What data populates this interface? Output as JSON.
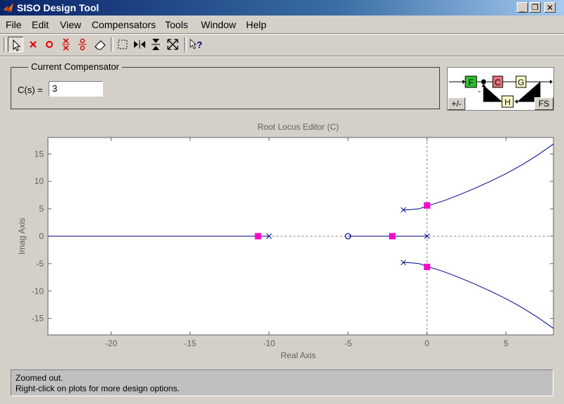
{
  "window": {
    "title": "SISO Design Tool",
    "controls": [
      "_",
      "❐",
      "✕"
    ]
  },
  "menu": [
    "File",
    "Edit",
    "View",
    "Compensators",
    "Tools",
    "Window",
    "Help"
  ],
  "toolbar": [
    {
      "name": "select-arrow-icon"
    },
    {
      "name": "add-real-pole-icon"
    },
    {
      "name": "add-real-zero-icon"
    },
    {
      "name": "add-complex-pole-icon"
    },
    {
      "name": "add-complex-zero-icon"
    },
    {
      "name": "eraser-icon"
    },
    {
      "name": "zoom-box-icon"
    },
    {
      "name": "zoom-x-icon"
    },
    {
      "name": "zoom-y-icon"
    },
    {
      "name": "zoom-fit-icon"
    },
    {
      "name": "whats-this-help-icon"
    }
  ],
  "compensator": {
    "legend": "Current Compensator",
    "label": "C(s) =",
    "value": "3"
  },
  "block_diagram": {
    "blocks": [
      "F",
      "C",
      "G",
      "H"
    ],
    "minus": "-",
    "sign_button": "+/-",
    "fs_button": "FS"
  },
  "colors": {
    "F": "#2fbf2f",
    "C": "#e8747a",
    "G": "#ffffcc",
    "H": "#ffffcc",
    "locus": "#00008b",
    "marker": "#ff00cc"
  },
  "chart_data": {
    "type": "line",
    "title": "Root Locus Editor (C)",
    "xlabel": "Real Axis",
    "ylabel": "Imag Axis",
    "xlim": [
      -24,
      8
    ],
    "ylim": [
      -18,
      18
    ],
    "xticks": [
      -20,
      -15,
      -10,
      -5,
      0,
      5
    ],
    "yticks": [
      -15,
      -10,
      -5,
      0,
      5,
      10,
      15
    ],
    "series": [
      {
        "values": [
          [
            -24,
            0
          ],
          [
            -10,
            0
          ]
        ]
      },
      {
        "values": [
          [
            -5,
            0
          ],
          [
            0,
            0
          ]
        ]
      },
      {
        "values": [
          [
            -1.5,
            4.8
          ],
          [
            -1,
            4.85
          ],
          [
            -0.5,
            5.0
          ],
          [
            0,
            5.5
          ],
          [
            1,
            6.4
          ],
          [
            2,
            7.5
          ],
          [
            3,
            8.7
          ],
          [
            4,
            10.0
          ],
          [
            5,
            11.4
          ],
          [
            6,
            13.0
          ],
          [
            7,
            14.8
          ],
          [
            8,
            16.8
          ]
        ]
      },
      {
        "values": [
          [
            -1.5,
            -4.8
          ],
          [
            -1,
            -4.85
          ],
          [
            -0.5,
            -5.0
          ],
          [
            0,
            -5.5
          ],
          [
            1,
            -6.4
          ],
          [
            2,
            -7.5
          ],
          [
            3,
            -8.7
          ],
          [
            4,
            -10.0
          ],
          [
            5,
            -11.4
          ],
          [
            6,
            -13.0
          ],
          [
            7,
            -14.8
          ],
          [
            8,
            -16.8
          ]
        ]
      }
    ],
    "poles": [
      [
        -10,
        0
      ],
      [
        0,
        0
      ],
      [
        -1.5,
        4.8
      ],
      [
        -1.5,
        -4.8
      ]
    ],
    "zeros": [
      [
        -5,
        0
      ]
    ],
    "closed_loop_poles": [
      [
        -10.7,
        0
      ],
      [
        -2.2,
        0
      ],
      [
        0,
        5.6
      ],
      [
        0,
        -5.6
      ]
    ]
  },
  "status": {
    "line1": "Zoomed out.",
    "line2": "Right-click on plots for more design options."
  }
}
